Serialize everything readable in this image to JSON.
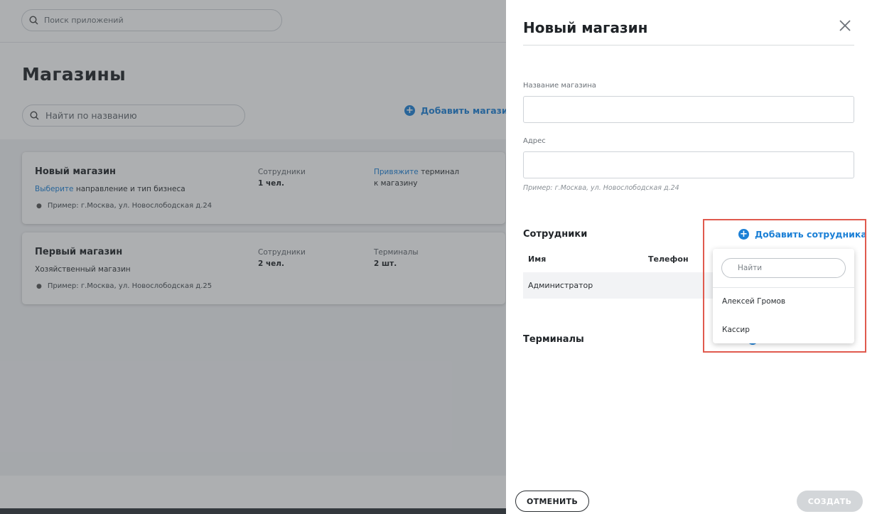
{
  "app_search": {
    "placeholder": "Поиск приложений"
  },
  "page": {
    "title": "Магазины",
    "search_placeholder": "Найти по названию",
    "add_shop_label": "Добавить магазин"
  },
  "shops": [
    {
      "name": "Новый магазин",
      "subtitle_link": "Выберите",
      "subtitle_rest": " направление и тип бизнеса",
      "address": "Пример: г.Москва, ул. Новослободская д.24",
      "employees_label": "Сотрудники",
      "employees_value": "1 чел.",
      "terminal_link": "Привяжите",
      "terminal_rest": " терминал",
      "terminal_line2": "к магазину"
    },
    {
      "name": "Первый магазин",
      "subtitle": "Хозяйственный магазин",
      "address": "Пример: г.Москва, ул. Новослободская д.25",
      "employees_label": "Сотрудники",
      "employees_value": "2 чел.",
      "terminals_label": "Терминалы",
      "terminals_value": "2 шт."
    }
  ],
  "panel": {
    "title": "Новый магазин",
    "name_label": "Название магазина",
    "name_value": "",
    "address_label": "Адрес",
    "address_value": "",
    "address_hint": "Пример: г.Москва, ул. Новослободская д.24",
    "employees_section": "Сотрудники",
    "add_employee_label": "Добавить  сотрудника",
    "table_headers": {
      "name": "Имя",
      "phone": "Телефон"
    },
    "employees": [
      "Администратор"
    ],
    "terminals_section": "Терминалы",
    "cancel_label": "ОТМЕНИТЬ",
    "create_label": "СОЗДАТЬ"
  },
  "dropdown": {
    "search_placeholder": "Найти",
    "items": [
      "Алексей Громов",
      "Кассир"
    ]
  },
  "colors": {
    "accent": "#1c80d6",
    "highlight": "#e05a4e",
    "disabled_button": "#d3d6d9"
  }
}
